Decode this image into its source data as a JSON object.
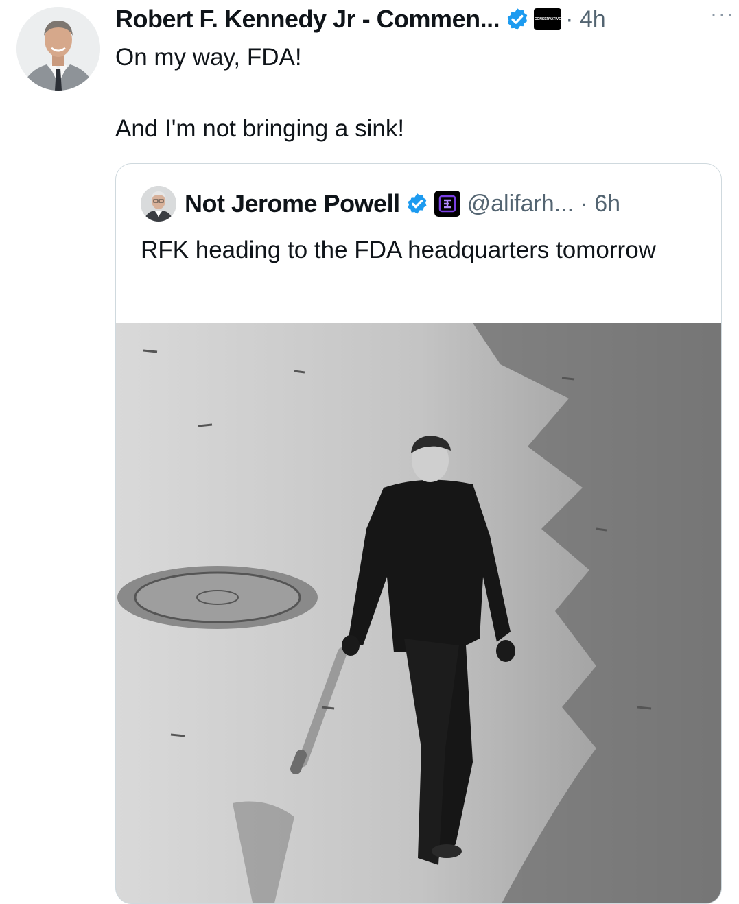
{
  "tweet": {
    "author_name": "Robert F. Kennedy Jr - Commen...",
    "affiliation_badge": "CONSERVATIVE",
    "time": "· 4h",
    "more": "···",
    "lines": [
      "On my way, FDA!",
      "And I'm not bringing a sink!"
    ]
  },
  "quoted_tweet": {
    "author_name": "Not Jerome Powell",
    "handle_time": "@alifarh... · 6h",
    "text": "RFK heading to the FDA headquarters tomorrow",
    "media": "black-and-white photo of a man in a leather jacket walking down a street carrying a baseball bat, next to a manhole cover"
  },
  "colors": {
    "verified": "#1d9bf0",
    "secondary_text": "#536471",
    "border": "#cfd9de",
    "affiliation_purple": "#7b3fe4"
  },
  "icons": [
    "verified-badge-icon",
    "affiliation-badge-icon",
    "more-options-icon"
  ]
}
